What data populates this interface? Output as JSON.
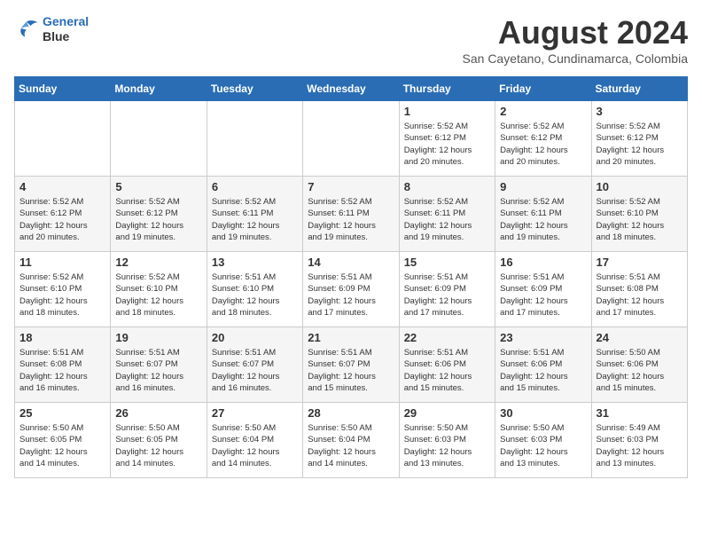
{
  "logo": {
    "line1": "General",
    "line2": "Blue"
  },
  "title": "August 2024",
  "subtitle": "San Cayetano, Cundinamarca, Colombia",
  "days_of_week": [
    "Sunday",
    "Monday",
    "Tuesday",
    "Wednesday",
    "Thursday",
    "Friday",
    "Saturday"
  ],
  "weeks": [
    [
      {
        "day": "",
        "info": ""
      },
      {
        "day": "",
        "info": ""
      },
      {
        "day": "",
        "info": ""
      },
      {
        "day": "",
        "info": ""
      },
      {
        "day": "1",
        "info": "Sunrise: 5:52 AM\nSunset: 6:12 PM\nDaylight: 12 hours\nand 20 minutes."
      },
      {
        "day": "2",
        "info": "Sunrise: 5:52 AM\nSunset: 6:12 PM\nDaylight: 12 hours\nand 20 minutes."
      },
      {
        "day": "3",
        "info": "Sunrise: 5:52 AM\nSunset: 6:12 PM\nDaylight: 12 hours\nand 20 minutes."
      }
    ],
    [
      {
        "day": "4",
        "info": "Sunrise: 5:52 AM\nSunset: 6:12 PM\nDaylight: 12 hours\nand 20 minutes."
      },
      {
        "day": "5",
        "info": "Sunrise: 5:52 AM\nSunset: 6:12 PM\nDaylight: 12 hours\nand 19 minutes."
      },
      {
        "day": "6",
        "info": "Sunrise: 5:52 AM\nSunset: 6:11 PM\nDaylight: 12 hours\nand 19 minutes."
      },
      {
        "day": "7",
        "info": "Sunrise: 5:52 AM\nSunset: 6:11 PM\nDaylight: 12 hours\nand 19 minutes."
      },
      {
        "day": "8",
        "info": "Sunrise: 5:52 AM\nSunset: 6:11 PM\nDaylight: 12 hours\nand 19 minutes."
      },
      {
        "day": "9",
        "info": "Sunrise: 5:52 AM\nSunset: 6:11 PM\nDaylight: 12 hours\nand 19 minutes."
      },
      {
        "day": "10",
        "info": "Sunrise: 5:52 AM\nSunset: 6:10 PM\nDaylight: 12 hours\nand 18 minutes."
      }
    ],
    [
      {
        "day": "11",
        "info": "Sunrise: 5:52 AM\nSunset: 6:10 PM\nDaylight: 12 hours\nand 18 minutes."
      },
      {
        "day": "12",
        "info": "Sunrise: 5:52 AM\nSunset: 6:10 PM\nDaylight: 12 hours\nand 18 minutes."
      },
      {
        "day": "13",
        "info": "Sunrise: 5:51 AM\nSunset: 6:10 PM\nDaylight: 12 hours\nand 18 minutes."
      },
      {
        "day": "14",
        "info": "Sunrise: 5:51 AM\nSunset: 6:09 PM\nDaylight: 12 hours\nand 17 minutes."
      },
      {
        "day": "15",
        "info": "Sunrise: 5:51 AM\nSunset: 6:09 PM\nDaylight: 12 hours\nand 17 minutes."
      },
      {
        "day": "16",
        "info": "Sunrise: 5:51 AM\nSunset: 6:09 PM\nDaylight: 12 hours\nand 17 minutes."
      },
      {
        "day": "17",
        "info": "Sunrise: 5:51 AM\nSunset: 6:08 PM\nDaylight: 12 hours\nand 17 minutes."
      }
    ],
    [
      {
        "day": "18",
        "info": "Sunrise: 5:51 AM\nSunset: 6:08 PM\nDaylight: 12 hours\nand 16 minutes."
      },
      {
        "day": "19",
        "info": "Sunrise: 5:51 AM\nSunset: 6:07 PM\nDaylight: 12 hours\nand 16 minutes."
      },
      {
        "day": "20",
        "info": "Sunrise: 5:51 AM\nSunset: 6:07 PM\nDaylight: 12 hours\nand 16 minutes."
      },
      {
        "day": "21",
        "info": "Sunrise: 5:51 AM\nSunset: 6:07 PM\nDaylight: 12 hours\nand 15 minutes."
      },
      {
        "day": "22",
        "info": "Sunrise: 5:51 AM\nSunset: 6:06 PM\nDaylight: 12 hours\nand 15 minutes."
      },
      {
        "day": "23",
        "info": "Sunrise: 5:51 AM\nSunset: 6:06 PM\nDaylight: 12 hours\nand 15 minutes."
      },
      {
        "day": "24",
        "info": "Sunrise: 5:50 AM\nSunset: 6:06 PM\nDaylight: 12 hours\nand 15 minutes."
      }
    ],
    [
      {
        "day": "25",
        "info": "Sunrise: 5:50 AM\nSunset: 6:05 PM\nDaylight: 12 hours\nand 14 minutes."
      },
      {
        "day": "26",
        "info": "Sunrise: 5:50 AM\nSunset: 6:05 PM\nDaylight: 12 hours\nand 14 minutes."
      },
      {
        "day": "27",
        "info": "Sunrise: 5:50 AM\nSunset: 6:04 PM\nDaylight: 12 hours\nand 14 minutes."
      },
      {
        "day": "28",
        "info": "Sunrise: 5:50 AM\nSunset: 6:04 PM\nDaylight: 12 hours\nand 14 minutes."
      },
      {
        "day": "29",
        "info": "Sunrise: 5:50 AM\nSunset: 6:03 PM\nDaylight: 12 hours\nand 13 minutes."
      },
      {
        "day": "30",
        "info": "Sunrise: 5:50 AM\nSunset: 6:03 PM\nDaylight: 12 hours\nand 13 minutes."
      },
      {
        "day": "31",
        "info": "Sunrise: 5:49 AM\nSunset: 6:03 PM\nDaylight: 12 hours\nand 13 minutes."
      }
    ]
  ]
}
